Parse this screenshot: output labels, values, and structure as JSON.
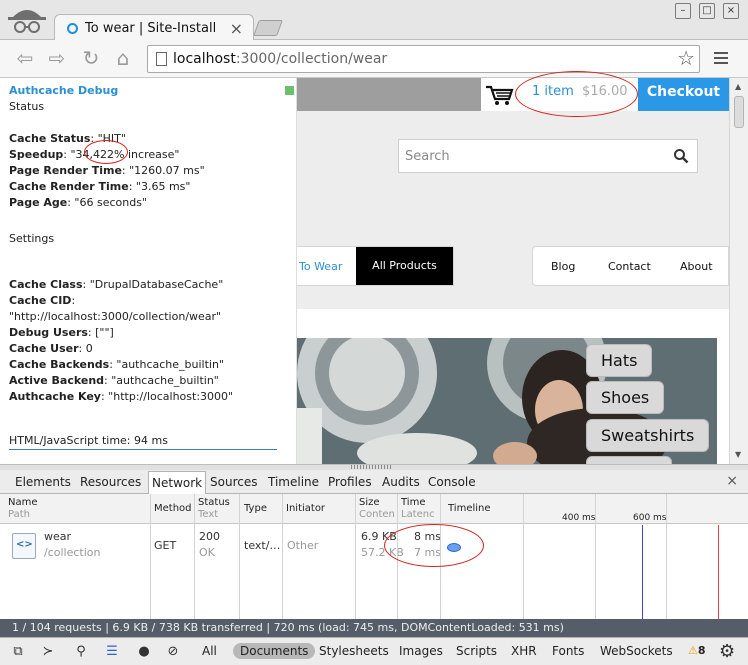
{
  "browser": {
    "tab_title": "To wear | Site-Install",
    "url_host": "localhost",
    "url_path": ":3000/collection/wear"
  },
  "debug": {
    "title": "Authcache Debug",
    "status_heading": "Status",
    "status": [
      {
        "key": "Cache Status",
        "value": ": \"HIT\""
      },
      {
        "key": "Speedup",
        "value": ": \"34,422% increase\""
      },
      {
        "key": "Page Render Time",
        "value": ": \"1260.07 ms\""
      },
      {
        "key": "Cache Render Time",
        "value": ": \"3.65 ms\""
      },
      {
        "key": "Page Age",
        "value": ": \"66 seconds\""
      }
    ],
    "settings_heading": "Settings",
    "settings": [
      {
        "key": "Cache Class",
        "value": ": \"DrupalDatabaseCache\""
      },
      {
        "key": "Cache CID",
        "value": ": \"http://localhost:3000/collection/wear\""
      },
      {
        "key": "Debug Users",
        "value": ": [\"\"]"
      },
      {
        "key": "Cache User",
        "value": ": 0"
      },
      {
        "key": "Cache Backends",
        "value": ": \"authcache_builtin\""
      },
      {
        "key": "Active Backend",
        "value": ": \"authcache_builtin\""
      },
      {
        "key": "Authcache Key",
        "value": ": \"http://localhost:3000\""
      }
    ],
    "footer": "HTML/JavaScript time: 94 ms"
  },
  "site": {
    "cart_items": "1 item",
    "cart_price": "$16.00",
    "checkout_label": "Checkout",
    "search_placeholder": "Search",
    "nav_left": [
      "To Wear",
      "All Products"
    ],
    "nav_right": [
      "Blog",
      "Contact",
      "About"
    ],
    "categories": [
      "Hats",
      "Shoes",
      "Sweatshirts"
    ]
  },
  "devtools": {
    "tabs": [
      "Elements",
      "Resources",
      "Network",
      "Sources",
      "Timeline",
      "Profiles",
      "Audits",
      "Console"
    ],
    "active_tab": "Network",
    "columns": [
      {
        "title": "Name",
        "sub": "Path"
      },
      {
        "title": "Method",
        "sub": ""
      },
      {
        "title": "Status",
        "sub": "Text"
      },
      {
        "title": "Type",
        "sub": ""
      },
      {
        "title": "Initiator",
        "sub": ""
      },
      {
        "title": "Size",
        "sub": "Conten"
      },
      {
        "title": "Time",
        "sub": "Latenc"
      },
      {
        "title": "Timeline",
        "sub": ""
      }
    ],
    "timeline_ticks": [
      "400 ms",
      "600 ms"
    ],
    "request": {
      "name": "wear",
      "path": "/collection",
      "method": "GET",
      "status": "200",
      "status_text": "OK",
      "type": "text/…",
      "initiator": "Other",
      "size": "6.9 KB",
      "content": "57.2 KB",
      "time": "8 ms",
      "latency": "7 ms"
    },
    "summary": "1 / 104 requests  |  6.9 KB / 738 KB transferred  |  720 ms (load: 745 ms, DOMContentLoaded: 531 ms)",
    "filters": [
      "All",
      "Documents",
      "Stylesheets",
      "Images",
      "Scripts",
      "XHR",
      "Fonts",
      "WebSockets"
    ],
    "active_filter": "Documents",
    "warnings": "8",
    "colors": {
      "accent": "#2a98e6",
      "annotation": "#d6241d",
      "summary_bg": "#555d68"
    }
  }
}
